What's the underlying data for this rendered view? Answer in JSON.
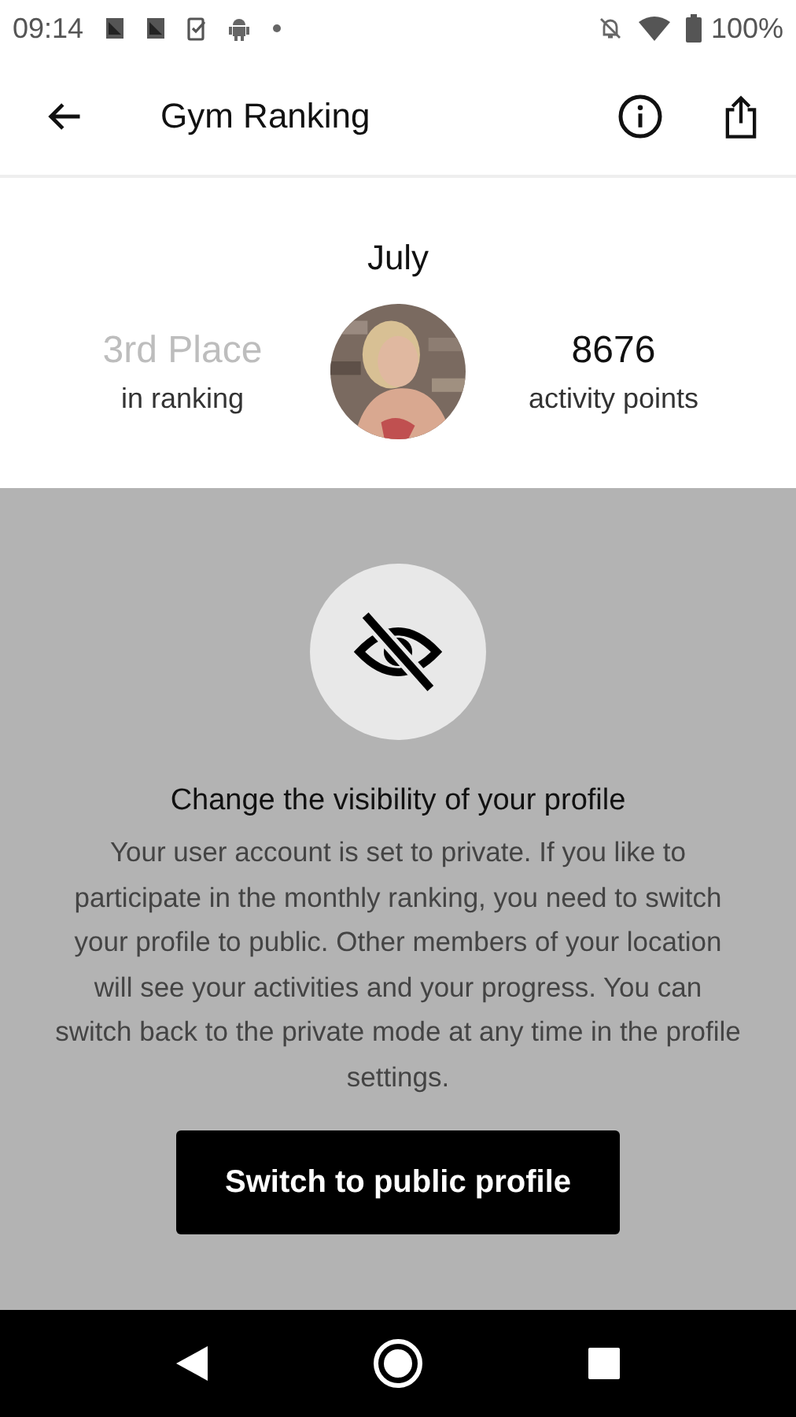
{
  "status_bar": {
    "time": "09:14",
    "battery": "100%"
  },
  "app_bar": {
    "title": "Gym Ranking"
  },
  "header": {
    "month": "July",
    "rank": "3rd Place",
    "rank_caption": "in ranking",
    "points": "8676",
    "points_caption": "activity points"
  },
  "dialog": {
    "title": "Change the visibility of your profile",
    "message": "Your user account is set to private. If you like to participate in the monthly ranking, you need to switch your profile to public. Other members of your location will see your activities and your progress. You can switch back to the private mode at any time in the profile settings.",
    "button": "Switch to public profile"
  }
}
